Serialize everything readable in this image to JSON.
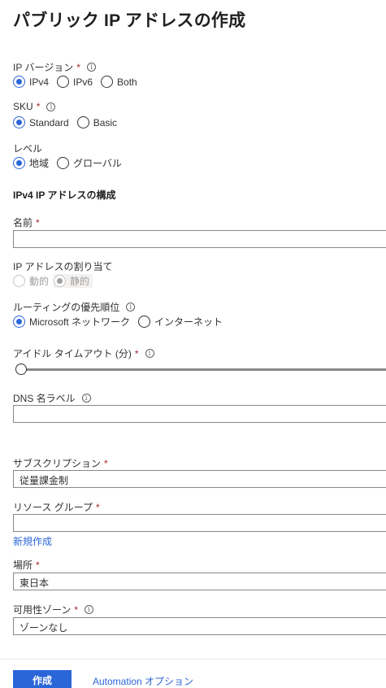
{
  "page": {
    "title": "パブリック IP アドレスの作成",
    "more_label": "···"
  },
  "ip_version": {
    "label": "IP バージョン",
    "required": "*",
    "info": "i",
    "options": [
      "IPv4",
      "IPv6",
      "Both"
    ],
    "selected": "IPv4"
  },
  "sku": {
    "label": "SKU",
    "required": "*",
    "info": "i",
    "options": [
      "Standard",
      "Basic"
    ],
    "selected": "Standard"
  },
  "level": {
    "label": "レベル",
    "options": [
      "地域",
      "グローバル"
    ],
    "selected": "地域"
  },
  "ipv4_config": {
    "heading": "IPv4 IP アドレスの構成"
  },
  "name": {
    "label": "名前",
    "required": "*",
    "value": ""
  },
  "assignment": {
    "label": "IP アドレスの割り当て",
    "options": [
      "動的",
      "静的"
    ],
    "selected": "静的"
  },
  "routing": {
    "label": "ルーティングの優先順位",
    "info": "i",
    "options": [
      "Microsoft ネットワーク",
      "インターネット"
    ],
    "selected": "Microsoft ネットワーク"
  },
  "idle_timeout": {
    "label": "アイドル タイムアウト (分)",
    "required": "*",
    "info": "i",
    "slider_fraction": 0.0
  },
  "dns": {
    "label": "DNS 名ラベル",
    "info": "i",
    "value": ""
  },
  "subscription": {
    "label": "サブスクリプション",
    "required": "*",
    "value": "従量課金制"
  },
  "resource_group": {
    "label": "リソース グループ",
    "required": "*",
    "value": "",
    "create_new_link": "新規作成"
  },
  "location": {
    "label": "場所",
    "required": "*",
    "value": "東日本"
  },
  "availability_zone": {
    "label": "可用性ゾーン",
    "required": "*",
    "info": "i",
    "value": "ゾーンなし"
  },
  "footer": {
    "create_label": "作成",
    "automation_label": "Automation オプション"
  },
  "colors": {
    "accent": "#2b66d8",
    "required": "#a4262c",
    "border": "#8a8886"
  }
}
